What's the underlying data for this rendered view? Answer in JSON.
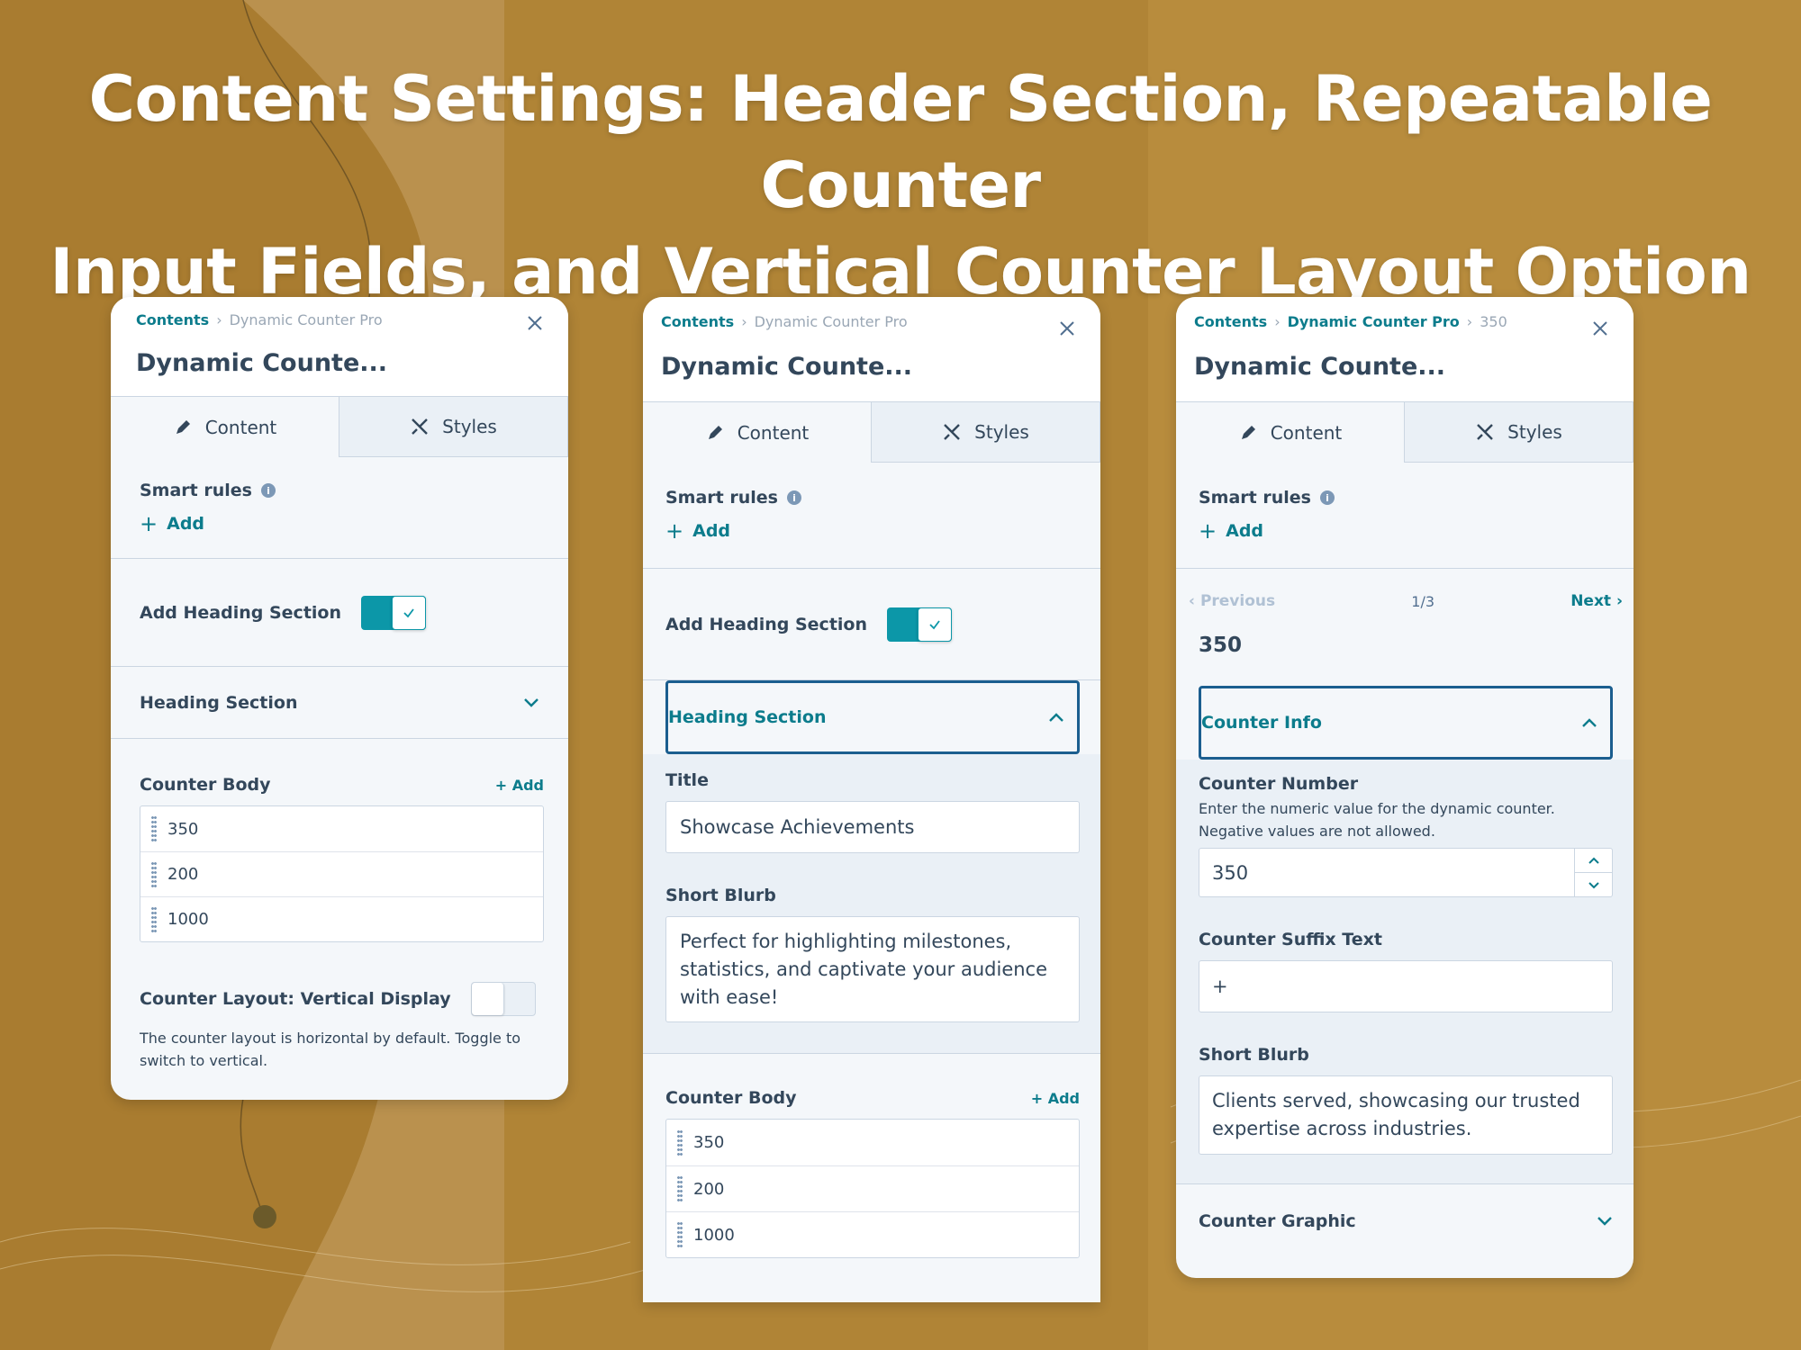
{
  "headline": {
    "line1": "Content Settings: Header Section, Repeatable Counter",
    "line2": "Input Fields, and Vertical Counter Layout Option"
  },
  "colors": {
    "accent": "#0c7c8c",
    "toggle_on": "#0c97a8",
    "focus_border": "#1b5e8f",
    "text": "#33475b",
    "background": "#b08436"
  },
  "panel1": {
    "crumbs": [
      "Contents",
      "Dynamic Counter Pro"
    ],
    "title": "Dynamic Counte...",
    "tabs": {
      "content": "Content",
      "styles": "Styles"
    },
    "smart_rules": "Smart rules",
    "add": "Add",
    "heading_toggle": {
      "label": "Add Heading Section",
      "on": true
    },
    "heading_section": "Heading Section",
    "counter_body": {
      "label": "Counter Body",
      "add": "+ Add",
      "items": [
        "350",
        "200",
        "1000"
      ]
    },
    "layout_toggle": {
      "label": "Counter Layout: Vertical Display",
      "on": false,
      "help": "The counter layout is horizontal by default. Toggle to switch to vertical."
    }
  },
  "panel2": {
    "crumbs": [
      "Contents",
      "Dynamic Counter Pro"
    ],
    "title": "Dynamic Counte...",
    "tabs": {
      "content": "Content",
      "styles": "Styles"
    },
    "smart_rules": "Smart rules",
    "add": "Add",
    "heading_toggle": {
      "label": "Add Heading Section",
      "on": true
    },
    "heading_section": "Heading Section",
    "title_field": {
      "label": "Title",
      "value": "Showcase Achievements"
    },
    "blurb_field": {
      "label": "Short Blurb",
      "value": "Perfect for highlighting milestones, statistics, and captivate your audience with ease!"
    },
    "counter_body": {
      "label": "Counter Body",
      "add": "+ Add",
      "items": [
        "350",
        "200",
        "1000"
      ]
    }
  },
  "panel3": {
    "crumbs": [
      "Contents",
      "Dynamic Counter Pro",
      "350"
    ],
    "title": "Dynamic Counte...",
    "tabs": {
      "content": "Content",
      "styles": "Styles"
    },
    "smart_rules": "Smart rules",
    "add": "Add",
    "pager": {
      "prev": "Previous",
      "count": "1/3",
      "next": "Next"
    },
    "item_title": "350",
    "counter_info": "Counter Info",
    "number_field": {
      "label": "Counter Number",
      "help": "Enter the numeric value for the dynamic counter. Negative values are not allowed.",
      "value": "350"
    },
    "suffix_field": {
      "label": "Counter Suffix Text",
      "value": "+"
    },
    "blurb_field": {
      "label": "Short Blurb",
      "value": "Clients served, showcasing our trusted expertise across industries."
    },
    "counter_graphic": "Counter Graphic"
  }
}
